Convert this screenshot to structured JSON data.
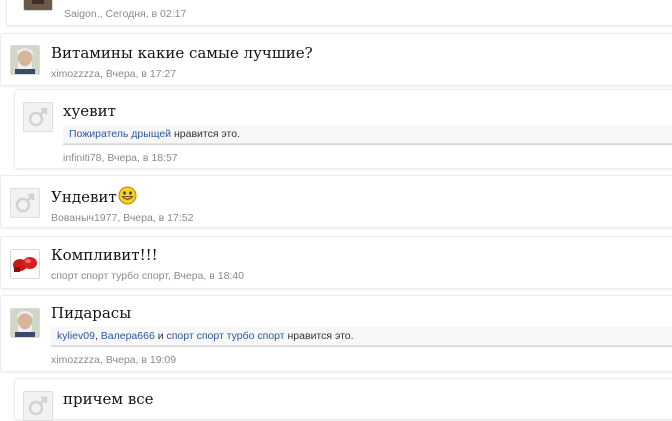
{
  "posts": [
    {
      "author": "Saigon.",
      "date": "Сегодня, в 02:17"
    },
    {
      "message": "Витамины какие самые лучшие?",
      "author": "ximozzzza",
      "date": "Вчера, в 17:27"
    },
    {
      "message": "хуевит",
      "likes": {
        "users": [
          "Пожиратель дрыщей"
        ],
        "suffix": " нравится это."
      },
      "author": "infiniti78",
      "date": "Вчера, в 18:57"
    },
    {
      "message": "Ундевит",
      "author": "Вованыч1977",
      "date": "Вчера, в 17:52"
    },
    {
      "message": "Компливит!!!",
      "author": "спорт спорт турбо спорт",
      "date": "Вчера, в 18:40"
    },
    {
      "message": "Пидарасы",
      "likes": {
        "users": [
          "kyliev09",
          "Валера666",
          "спорт спорт турбо спорт"
        ],
        "sep1": ", ",
        "sep2": " и ",
        "suffix": " нравится это."
      },
      "author": "ximozzzza",
      "date": "Вчера, в 19:09"
    },
    {
      "message": "причем все"
    }
  ],
  "meta_separator": ", ",
  "icons": [
    "male-placeholder-icon",
    "grin-smiley-icon"
  ],
  "colors": {
    "link": "#2a5a9a",
    "meta": "#8a8a8a",
    "text": "#141414"
  }
}
